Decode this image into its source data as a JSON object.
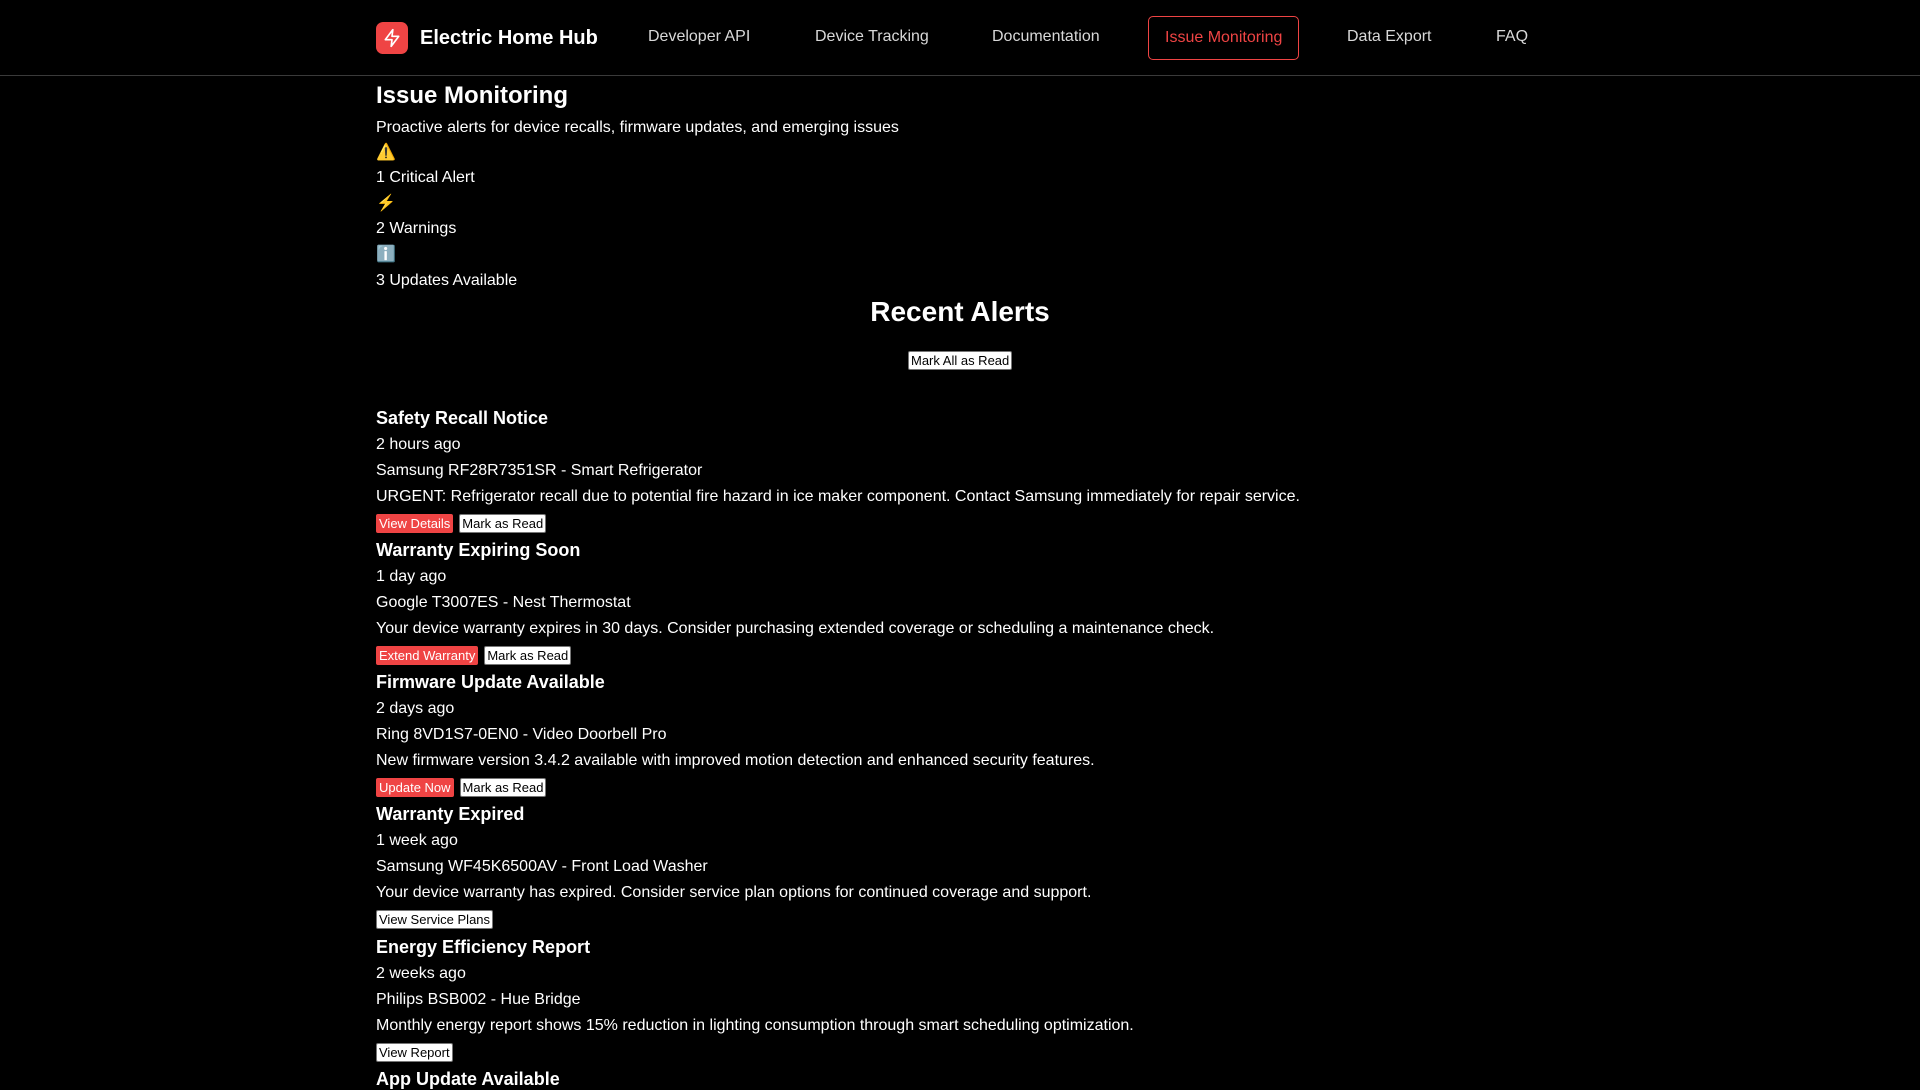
{
  "brand": {
    "name": "Electric Home Hub",
    "icon": "lightning-bolt-icon",
    "accent_color": "#ef4444"
  },
  "nav": {
    "items": [
      {
        "label": "Developer API"
      },
      {
        "label": "Device Tracking"
      },
      {
        "label": "Documentation"
      },
      {
        "label": "Issue Monitoring",
        "active": true
      },
      {
        "label": "Data Export"
      },
      {
        "label": "FAQ"
      }
    ]
  },
  "page": {
    "title": "Issue Monitoring",
    "subtitle": "Proactive alerts for device recalls, firmware updates, and emerging issues"
  },
  "stats": [
    {
      "icon": "⚠️",
      "icon_name": "warning-icon",
      "label": "1 Critical Alert"
    },
    {
      "icon": "⚡",
      "icon_name": "lightning-icon",
      "label": "2 Warnings"
    },
    {
      "icon": "ℹ️",
      "icon_name": "info-icon",
      "label": "3 Updates Available"
    }
  ],
  "recent": {
    "title": "Recent Alerts",
    "mark_all_label": "Mark All as Read"
  },
  "alerts": [
    {
      "title": "Safety Recall Notice",
      "time": "2 hours ago",
      "device": "Samsung RF28R7351SR - Smart Refrigerator",
      "message": "URGENT: Refrigerator recall due to potential fire hazard in ice maker component. Contact Samsung immediately for repair service.",
      "primary_action": "View Details",
      "secondary_action": "Mark as Read"
    },
    {
      "title": "Warranty Expiring Soon",
      "time": "1 day ago",
      "device": "Google T3007ES - Nest Thermostat",
      "message": "Your device warranty expires in 30 days. Consider purchasing extended coverage or scheduling a maintenance check.",
      "primary_action": "Extend Warranty",
      "secondary_action": "Mark as Read"
    },
    {
      "title": "Firmware Update Available",
      "time": "2 days ago",
      "device": "Ring 8VD1S7-0EN0 - Video Doorbell Pro",
      "message": "New firmware version 3.4.2 available with improved motion detection and enhanced security features.",
      "primary_action": "Update Now",
      "secondary_action": "Mark as Read"
    },
    {
      "title": "Warranty Expired",
      "time": "1 week ago",
      "device": "Samsung WF45K6500AV - Front Load Washer",
      "message": "Your device warranty has expired. Consider service plan options for continued coverage and support.",
      "secondary_action": "View Service Plans"
    },
    {
      "title": "Energy Efficiency Report",
      "time": "2 weeks ago",
      "device": "Philips BSB002 - Hue Bridge",
      "message": "Monthly energy report shows 15% reduction in lighting consumption through smart scheduling optimization.",
      "secondary_action": "View Report"
    },
    {
      "title": "App Update Available"
    }
  ]
}
